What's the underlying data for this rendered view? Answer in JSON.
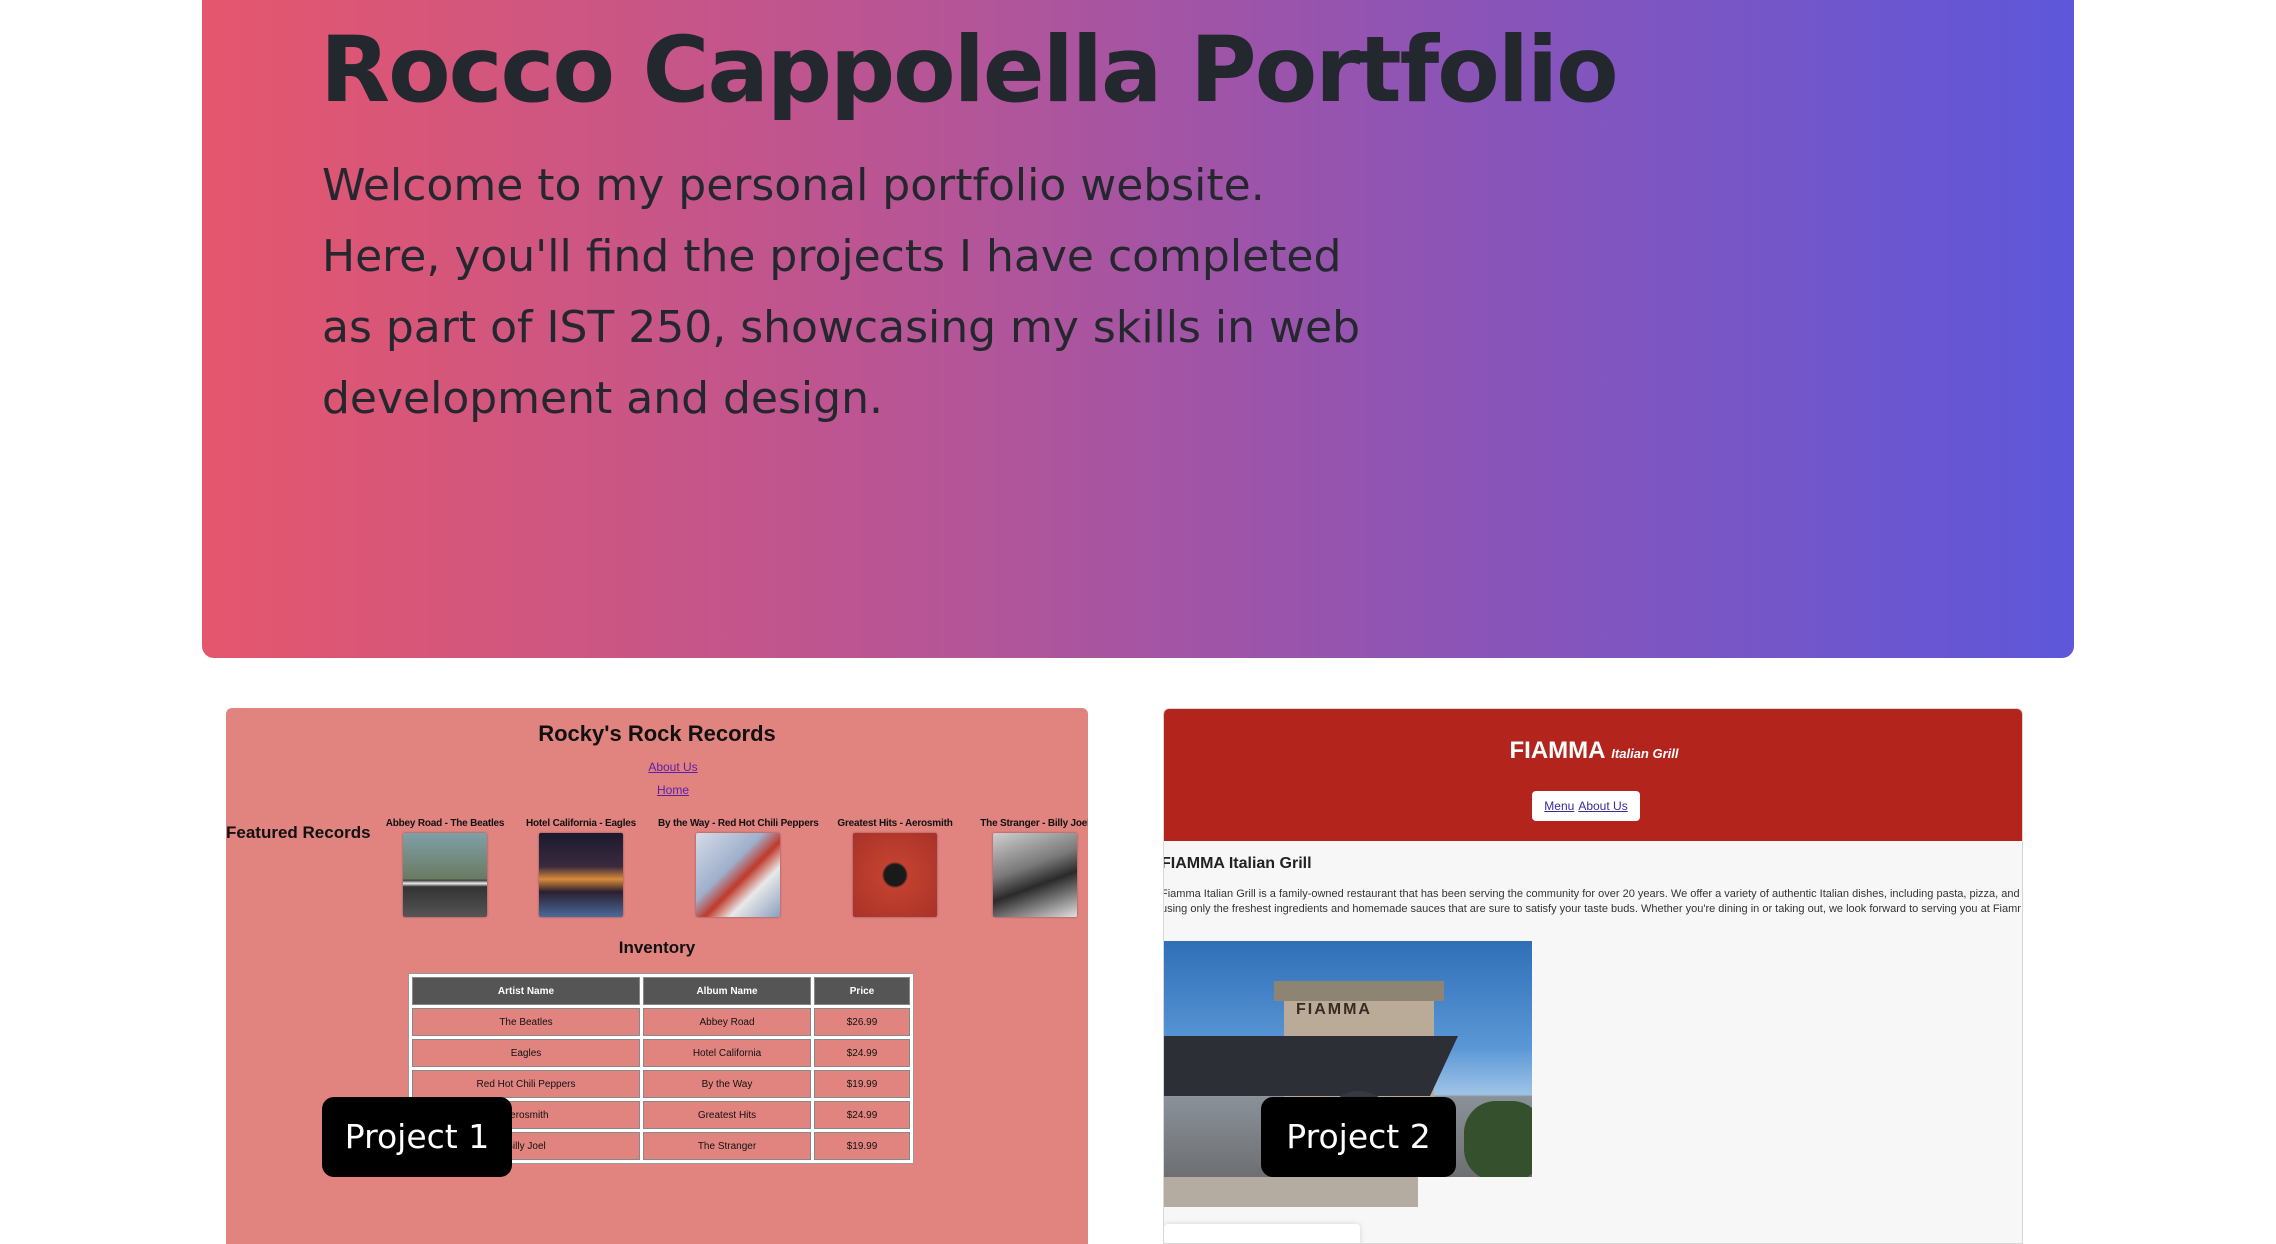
{
  "hero": {
    "title": "Rocco Cappolella Portfolio",
    "text": "Welcome to my personal portfolio website. Here, you'll find the projects I have completed as part of IST 250, showcasing my skills in web development and design."
  },
  "project1": {
    "badge": "Project 1",
    "site_title": "Rocky's Rock Records",
    "links": [
      "About Us",
      "Home"
    ],
    "featured_label": "Featured Records",
    "records": [
      {
        "caption": "Abbey Road - The Beatles",
        "color": "#6a7a62"
      },
      {
        "caption": "Hotel California - Eagles",
        "color": "#3a2a3e"
      },
      {
        "caption": "By the Way - Red Hot Chili Peppers",
        "color": "#b8c3d6"
      },
      {
        "caption": "Greatest Hits - Aerosmith",
        "color": "#c2412f"
      },
      {
        "caption": "The Stranger - Billy Joel",
        "color": "#4a4a4a"
      }
    ],
    "inventory_label": "Inventory",
    "table": {
      "headers": [
        "Artist Name",
        "Album Name",
        "Price"
      ],
      "rows": [
        [
          "The Beatles",
          "Abbey Road",
          "$26.99"
        ],
        [
          "Eagles",
          "Hotel California",
          "$24.99"
        ],
        [
          "Red Hot Chili Peppers",
          "By the Way",
          "$19.99"
        ],
        [
          "Aerosmith",
          "Greatest Hits",
          "$24.99"
        ],
        [
          "Billy Joel",
          "The Stranger",
          "$19.99"
        ]
      ]
    }
  },
  "project2": {
    "badge": "Project 2",
    "brand": "FIAMMA",
    "brand_sub": "Italian Grill",
    "nav": [
      "Menu",
      "About Us"
    ],
    "heading": "FIAMMA Italian Grill",
    "paragraph_1": "Fiamma Italian Grill is a family-owned restaurant that has been serving the community for over 20 years. We offer a variety of authentic Italian dishes, including pasta, pizza, and",
    "paragraph_2": "using only the freshest ingredients and homemade sauces that are sure to satisfy your taste buds. Whether you're dining in or taking out, we look forward to serving you at Fiamma.",
    "photo_sign": "FIAMMA"
  }
}
